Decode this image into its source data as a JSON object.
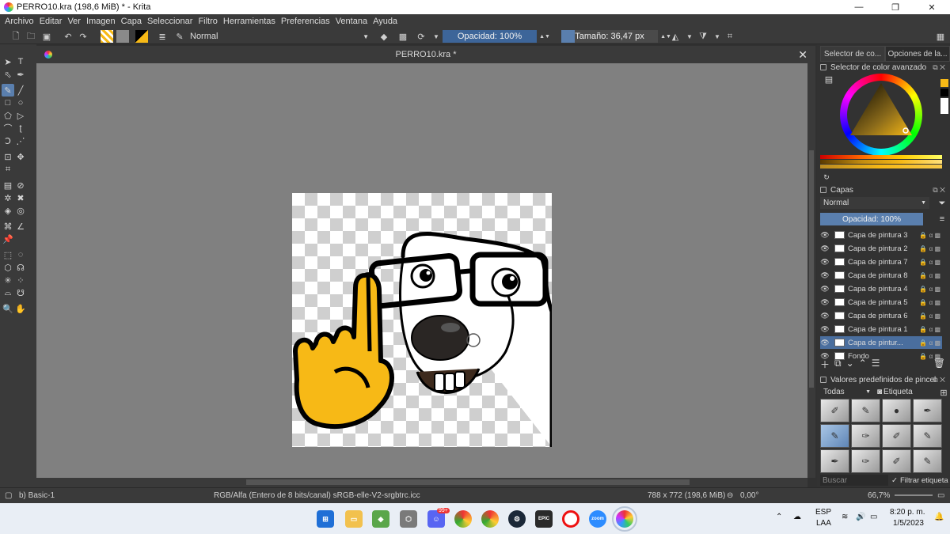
{
  "window": {
    "title": "PERRO10.kra (198,6 MiB)  * - Krita",
    "min": "—",
    "max": "❐",
    "close": "✕"
  },
  "menu": [
    "Archivo",
    "Editar",
    "Ver",
    "Imagen",
    "Capa",
    "Seleccionar",
    "Filtro",
    "Herramientas",
    "Preferencias",
    "Ventana",
    "Ayuda"
  ],
  "toolbar": {
    "blend_mode": "Normal",
    "opacity_label": "Opacidad: 100%",
    "opacity_value": 1.0,
    "size_label": "Tamaño: 36,47 px",
    "size_fraction": 0.14
  },
  "document": {
    "tab_title": "PERRO10.kra *"
  },
  "dock": {
    "tabs": [
      "Selector de co...",
      "Opciones de la..."
    ],
    "color_panel_title": "Selector de color avanzado",
    "layers_title": "Capas",
    "layers_blend": "Normal",
    "layers_opacity": "Opacidad:  100%",
    "layers": [
      {
        "name": "Capa de pintura 3",
        "selected": false
      },
      {
        "name": "Capa de pintura 2",
        "selected": false
      },
      {
        "name": "Capa de pintura 7",
        "selected": false
      },
      {
        "name": "Capa de pintura 8",
        "selected": false
      },
      {
        "name": "Capa de pintura 4",
        "selected": false
      },
      {
        "name": "Capa de pintura 5",
        "selected": false
      },
      {
        "name": "Capa de pintura 6",
        "selected": false
      },
      {
        "name": "Capa de pintura 1",
        "selected": false
      },
      {
        "name": "Capa de pintur...",
        "selected": true
      },
      {
        "name": "Fondo",
        "selected": false
      }
    ],
    "brush_title": "Valores predefinidos de pincel",
    "brush_filter": "Todas",
    "brush_tag": "Etiqueta",
    "search_placeholder": "Buscar",
    "filter_tag": "Filtrar etiqueta"
  },
  "status": {
    "brush": "b) Basic-1",
    "colorspace": "RGB/Alfa (Entero de 8 bits/canal)  sRGB-elle-V2-srgbtrc.icc",
    "dims": "788 x 772 (198,6 MiB)",
    "rotation": "0,00°",
    "zoom": "66,7%"
  },
  "taskbar": {
    "lang": "ESP",
    "lang2": "LAA",
    "time": "8:20 p. m.",
    "date": "1/5/2023",
    "badge": "99+",
    "epic": "EPIC",
    "zoom_app": "zoom"
  },
  "colors": {
    "accent": "#5a7fae",
    "yellow": "#f7b916"
  }
}
